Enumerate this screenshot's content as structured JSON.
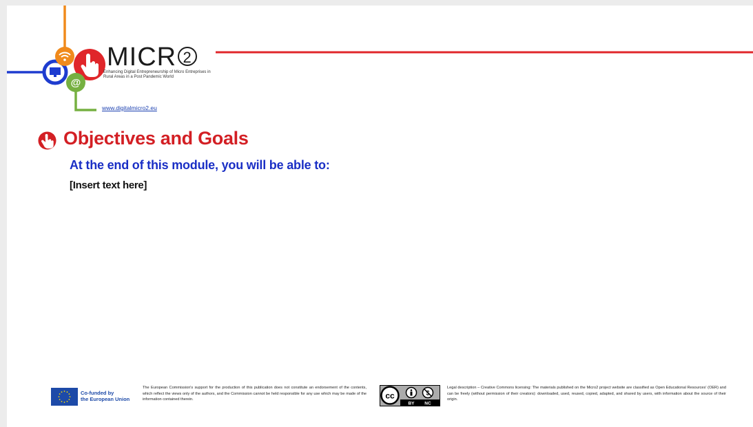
{
  "logo": {
    "wordmark": "MICR",
    "wordmark_number": "2",
    "tagline": "Enhancing Digital Entrepreneurship of Micro Entreprises in Rural Areas in a Post Pandemic World",
    "website": "www.digitalmicro2.eu",
    "colors": {
      "orange": "#f08a1c",
      "red": "#e0262a",
      "blue": "#1e3ccf",
      "green": "#76b041"
    }
  },
  "header": {
    "icon": "hand-pointer-icon",
    "title": "Objectives and Goals",
    "subtitle": "At the end of this module, you will be able to:"
  },
  "content": {
    "body": "[Insert text here]"
  },
  "footer": {
    "eu_label": "Co-funded by\nthe European Union",
    "disclaimer": "The European Commission's support for the production of this publication does not constitute an endorsement of the contents, which reflect the views only of the authors, and the Commission cannot be held responsible for any use which may be made of the information contained therein.",
    "license_badge": {
      "by": "BY",
      "nc": "NC"
    },
    "legal": "Legal description – Creative Commons licensing: The materials published on the Micro2 project website are classified as Open Educational Resources' (OER) and can be freely (without permission of their creators): downloaded, used, reused, copied, adapted, and shared by users, with information about the source of their origin."
  },
  "colors": {
    "accent_red": "#d31f24",
    "subtitle_blue": "#1a2fc5",
    "eu_blue": "#1d4aa8"
  }
}
